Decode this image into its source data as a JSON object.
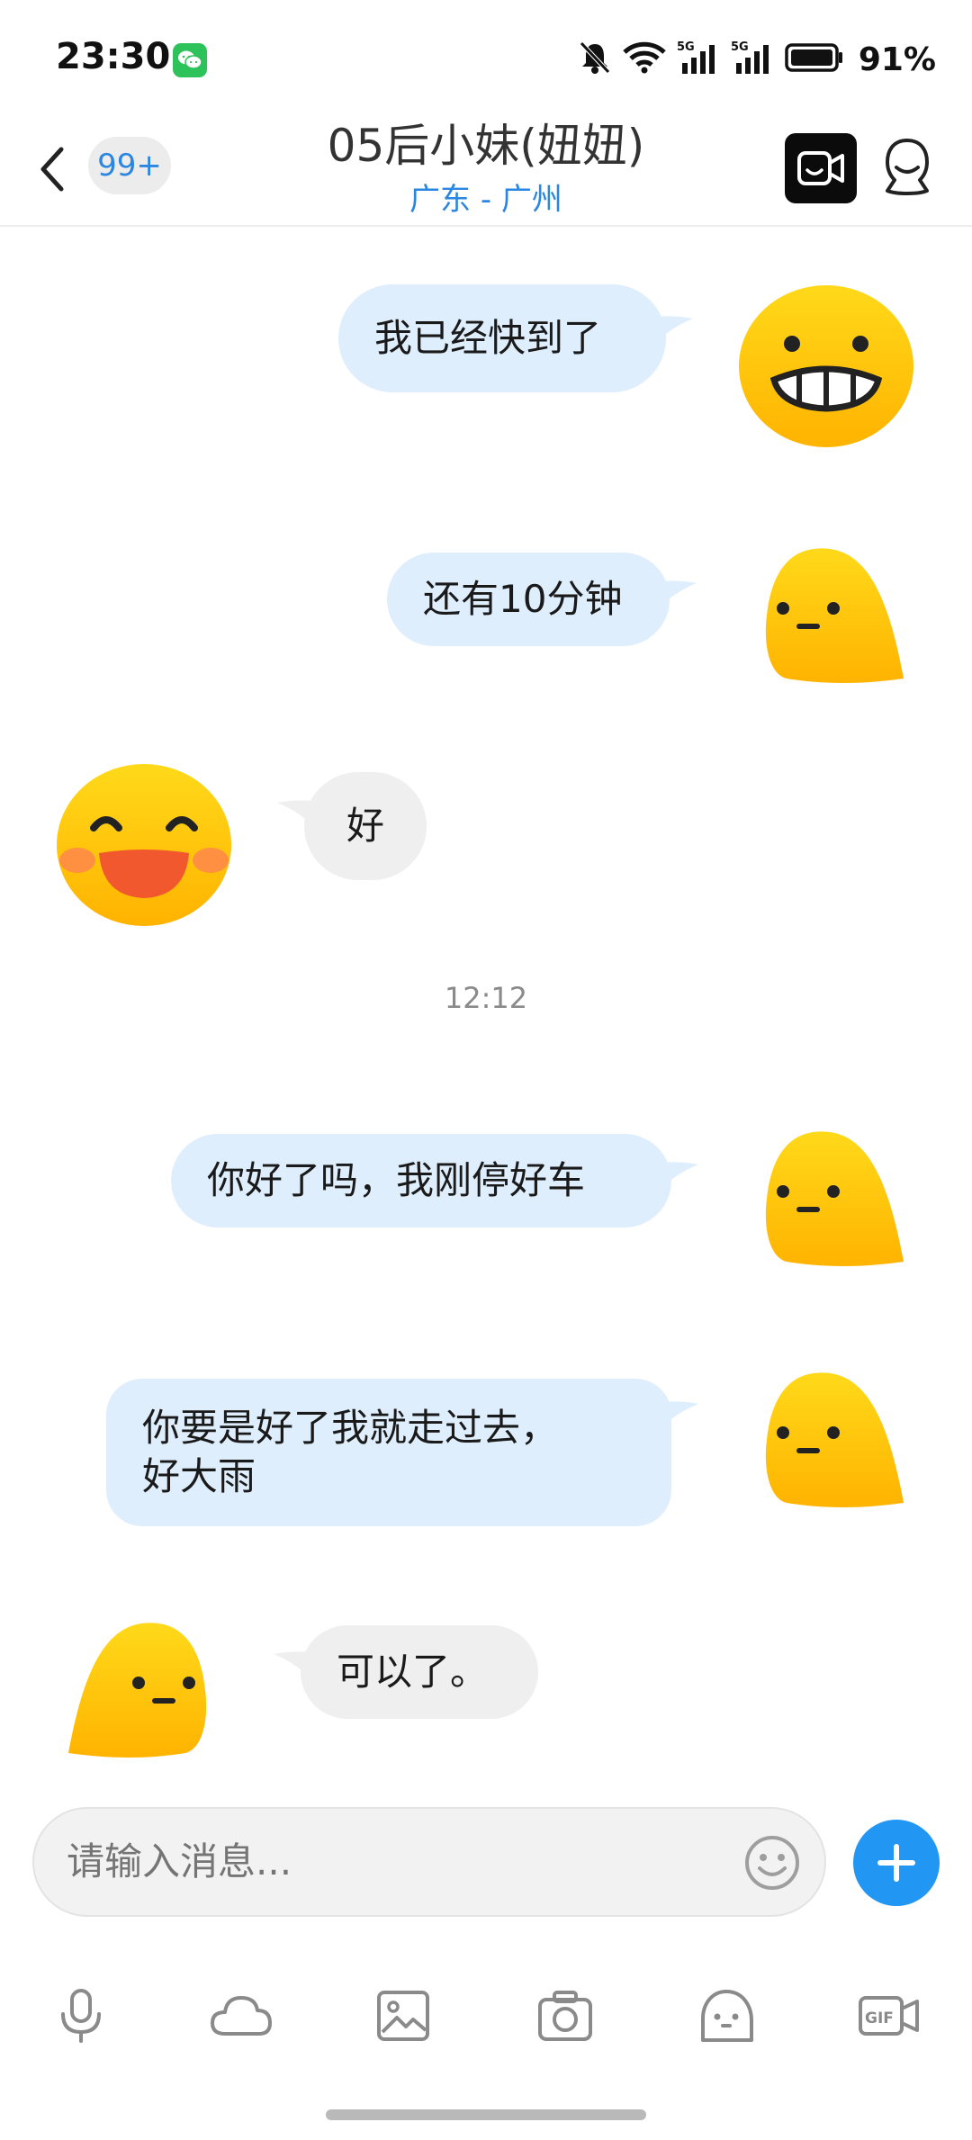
{
  "status_bar": {
    "time": "23:30",
    "battery_percent": "91%",
    "network_label_1": "5G",
    "network_label_2": "5G",
    "icons": [
      "wechat-icon",
      "mute-bell-icon",
      "wifi-icon",
      "signal-5g-icon",
      "signal-5g-icon",
      "battery-icon"
    ]
  },
  "header": {
    "back_icon": "chevron-left-icon",
    "unread_count": "99+",
    "title": "05后小妹(妞妞)",
    "subtitle": "广东 - 广州",
    "video_icon": "video-call-icon",
    "profile_icon": "profile-icon"
  },
  "messages": [
    {
      "direction": "outgoing",
      "text": "我已经快到了",
      "avatar": "grin-emoji-avatar"
    },
    {
      "direction": "outgoing",
      "text": "还有10分钟",
      "avatar": "blob-avatar"
    },
    {
      "direction": "incoming",
      "text": "好",
      "avatar": "laughing-emoji-avatar"
    },
    {
      "direction": "timestamp",
      "text": "12:12"
    },
    {
      "direction": "outgoing",
      "text": "你好了吗，我刚停好车",
      "avatar": "blob-avatar"
    },
    {
      "direction": "outgoing",
      "line1": "你要是好了我就走过去，",
      "line2": "好大雨",
      "avatar": "blob-avatar"
    },
    {
      "direction": "incoming",
      "text": "可以了。",
      "avatar": "blob-avatar"
    }
  ],
  "input": {
    "placeholder": "请输入消息..."
  },
  "toolbar": {
    "items": [
      "microphone-icon",
      "cloud-icon",
      "image-icon",
      "camera-icon",
      "sticker-icon",
      "gif-icon"
    ],
    "gif_label": "GIF"
  },
  "colors": {
    "accent": "#2196f3",
    "outgoing_bubble": "#dfeefc",
    "incoming_bubble": "#efefef",
    "subtitle_blue": "#2a86e0",
    "emoji_yellow": "#ffc60b"
  }
}
